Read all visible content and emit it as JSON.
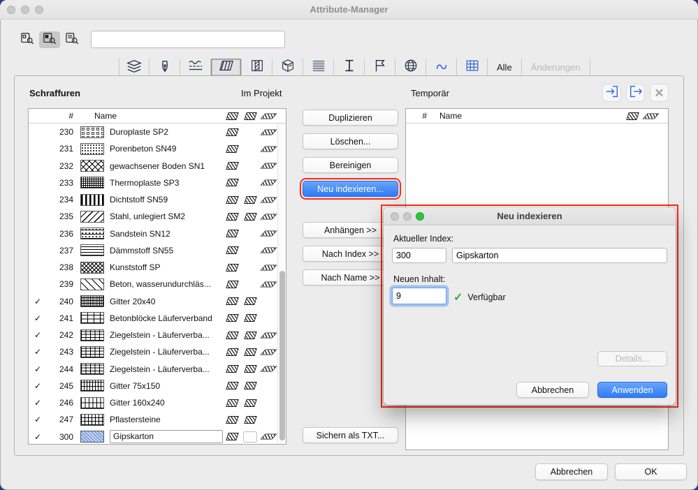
{
  "window": {
    "title": "Attribute-Manager",
    "footer": {
      "cancel": "Abbrechen",
      "ok": "OK"
    }
  },
  "toolbar": {
    "search_value": "",
    "buttons": [
      {
        "name": "search-mode-1",
        "icon": "doc-search-icon",
        "pressed": false
      },
      {
        "name": "search-mode-2",
        "icon": "doc-search-icon",
        "pressed": true
      },
      {
        "name": "search-mode-3",
        "icon": "doc-search-icon",
        "pressed": false
      }
    ]
  },
  "tabbar": {
    "icon_tabs": [
      {
        "name": "layers",
        "selected": false
      },
      {
        "name": "pens",
        "selected": false
      },
      {
        "name": "line-types",
        "selected": false
      },
      {
        "name": "fill-types",
        "selected": true
      },
      {
        "name": "composites",
        "selected": false
      },
      {
        "name": "building-materials",
        "selected": false
      },
      {
        "name": "surfaces",
        "selected": false
      },
      {
        "name": "profiles",
        "selected": false
      },
      {
        "name": "zone-categories",
        "selected": false
      },
      {
        "name": "cities",
        "selected": false
      },
      {
        "name": "markup-styles",
        "selected": false
      },
      {
        "name": "operation-profiles",
        "selected": false
      }
    ],
    "text_tabs": [
      {
        "label": "Alle",
        "enabled": true
      },
      {
        "label": "Änderungen",
        "enabled": false
      }
    ]
  },
  "project_panel": {
    "title": "Schraffuren",
    "header_label": "Im Projekt",
    "columns": {
      "index": "#",
      "name": "Name"
    },
    "rows": [
      {
        "checked": false,
        "index": "230",
        "name": "Duroplaste SP2",
        "pattern": "circles",
        "icons": {
          "draft": true,
          "cut": false,
          "cover": true
        },
        "selected": false
      },
      {
        "checked": false,
        "index": "231",
        "name": "Porenbeton SN49",
        "pattern": "dots",
        "icons": {
          "draft": true,
          "cut": false,
          "cover": true
        },
        "selected": false
      },
      {
        "checked": false,
        "index": "232",
        "name": "gewachsener Boden SN1",
        "pattern": "crosshatch",
        "icons": {
          "draft": true,
          "cut": false,
          "cover": true
        },
        "selected": false
      },
      {
        "checked": false,
        "index": "233",
        "name": "Thermoplaste SP3",
        "pattern": "mesh",
        "icons": {
          "draft": true,
          "cut": false,
          "cover": true
        },
        "selected": false
      },
      {
        "checked": false,
        "index": "234",
        "name": "Dichtstoff SN59",
        "pattern": "vbars",
        "icons": {
          "draft": true,
          "cut": true,
          "cover": true
        },
        "selected": false
      },
      {
        "checked": false,
        "index": "235",
        "name": "Stahl, unlegiert SM2",
        "pattern": "diagwide",
        "icons": {
          "draft": true,
          "cut": true,
          "cover": true
        },
        "selected": false
      },
      {
        "checked": false,
        "index": "236",
        "name": "Sandstein SN12",
        "pattern": "sand",
        "icons": {
          "draft": true,
          "cut": false,
          "cover": true
        },
        "selected": false
      },
      {
        "checked": false,
        "index": "237",
        "name": "Dämmstoff SN55",
        "pattern": "hlines",
        "icons": {
          "draft": true,
          "cut": false,
          "cover": true
        },
        "selected": false
      },
      {
        "checked": false,
        "index": "238",
        "name": "Kunststoff SP",
        "pattern": "diamond",
        "icons": {
          "draft": true,
          "cut": false,
          "cover": true
        },
        "selected": false
      },
      {
        "checked": false,
        "index": "239",
        "name": "Beton, wasserundurchläs...",
        "pattern": "diagsparse",
        "icons": {
          "draft": true,
          "cut": false,
          "cover": true
        },
        "selected": false
      },
      {
        "checked": true,
        "index": "240",
        "name": "Gitter 20x40",
        "pattern": "gridfine",
        "icons": {
          "draft": true,
          "cut": true,
          "cover": false
        },
        "selected": false
      },
      {
        "checked": true,
        "index": "241",
        "name": "Betonblöcke Läuferverband",
        "pattern": "brick",
        "icons": {
          "draft": true,
          "cut": true,
          "cover": false
        },
        "selected": false
      },
      {
        "checked": true,
        "index": "242",
        "name": "Ziegelstein - Läuferverba...",
        "pattern": "brickdense",
        "icons": {
          "draft": true,
          "cut": true,
          "cover": true
        },
        "selected": false
      },
      {
        "checked": true,
        "index": "243",
        "name": "Ziegelstein - Läuferverba...",
        "pattern": "brickdense",
        "icons": {
          "draft": true,
          "cut": true,
          "cover": true
        },
        "selected": false
      },
      {
        "checked": true,
        "index": "244",
        "name": "Ziegelstein - Läuferverba...",
        "pattern": "brickdense",
        "icons": {
          "draft": true,
          "cut": true,
          "cover": true
        },
        "selected": false
      },
      {
        "checked": true,
        "index": "245",
        "name": "Gitter 75x150",
        "pattern": "gridmed",
        "icons": {
          "draft": true,
          "cut": true,
          "cover": false
        },
        "selected": false
      },
      {
        "checked": true,
        "index": "246",
        "name": "Gitter 160x240",
        "pattern": "gridlarge",
        "icons": {
          "draft": true,
          "cut": true,
          "cover": false
        },
        "selected": false
      },
      {
        "checked": true,
        "index": "247",
        "name": "Pflastersteine",
        "pattern": "paving",
        "icons": {
          "draft": true,
          "cut": true,
          "cover": false
        },
        "selected": false
      },
      {
        "checked": true,
        "index": "300",
        "name": "Gipskarton",
        "pattern": "gips",
        "icons": {
          "draft": true,
          "cut": false,
          "cover": true
        },
        "selected": true
      }
    ]
  },
  "actions": {
    "duplicate": "Duplizieren",
    "delete": "Löschen...",
    "purge": "Bereinigen",
    "reindex": "Neu indexieren...",
    "append": "Anhängen >>",
    "by_index": "Nach Index >>",
    "by_name": "Nach Name >>",
    "save_txt": "Sichern als TXT..."
  },
  "temp_panel": {
    "title": "Temporär",
    "columns": {
      "index": "#",
      "name": "Name"
    },
    "tools": [
      "import-icon",
      "export-icon",
      "clear-icon"
    ]
  },
  "dialog": {
    "title": "Neu indexieren",
    "current_index_label": "Aktueller Index:",
    "current_index": "300",
    "current_name": "Gipskarton",
    "new_content_label": "Neuen Inhalt:",
    "new_index": "9",
    "availability": "Verfügbar",
    "details": "Details...",
    "cancel": "Abbrechen",
    "apply": "Anwenden"
  },
  "colors": {
    "accent_blue": "#2e7bf6",
    "highlight_red": "#ff2a12",
    "available_green": "#2fae3c",
    "gips_blue": "#c3d4f2"
  }
}
